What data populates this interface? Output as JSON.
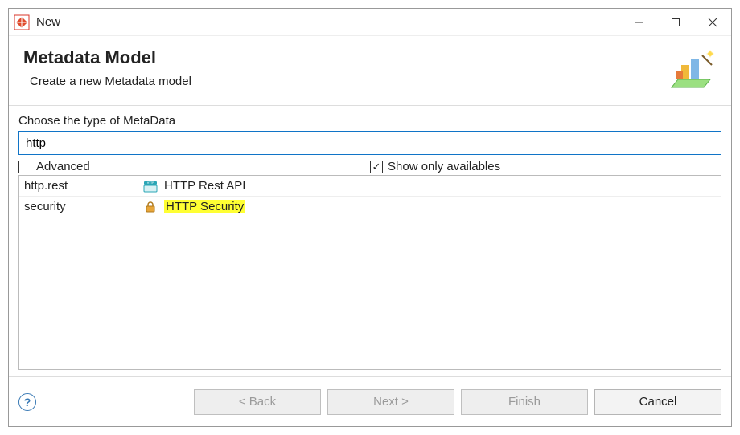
{
  "window": {
    "title": "New"
  },
  "header": {
    "title": "Metadata Model",
    "subtitle": "Create a new Metadata model"
  },
  "body": {
    "choose_label": "Choose the type of MetaData",
    "filter_value": "http",
    "advanced_label": "Advanced",
    "advanced_checked": false,
    "show_only_label": "Show only availables",
    "show_only_checked": true
  },
  "list": {
    "rows": [
      {
        "id": "http.rest",
        "icon": "http-icon",
        "label": "HTTP Rest API",
        "highlighted": false
      },
      {
        "id": "security",
        "icon": "lock-icon",
        "label": "HTTP Security",
        "highlighted": true
      }
    ]
  },
  "footer": {
    "back": "< Back",
    "next": "Next >",
    "finish": "Finish",
    "cancel": "Cancel"
  }
}
